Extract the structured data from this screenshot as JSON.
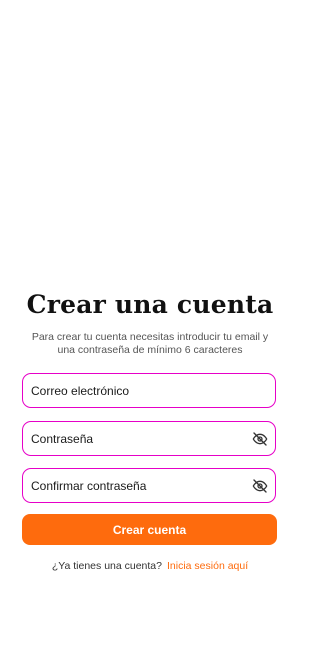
{
  "header": {
    "title": "Crear una cuenta",
    "subtitle": "Para crear tu cuenta necesitas introducir tu email y una contraseña de mínimo 6 caracteres"
  },
  "form": {
    "email": {
      "placeholder": "Correo electrónico",
      "value": ""
    },
    "password": {
      "placeholder": "Contraseña",
      "value": "",
      "icon": "eye-off-icon"
    },
    "confirm_password": {
      "placeholder": "Confirmar contraseña",
      "value": "",
      "icon": "eye-off-icon"
    },
    "submit_label": "Crear cuenta"
  },
  "footer": {
    "prompt": "¿Ya tienes una cuenta?",
    "link_label": "Inicia sesión aquí"
  },
  "colors": {
    "accent": "#fe6b0d",
    "field_border": "#e600c8"
  }
}
